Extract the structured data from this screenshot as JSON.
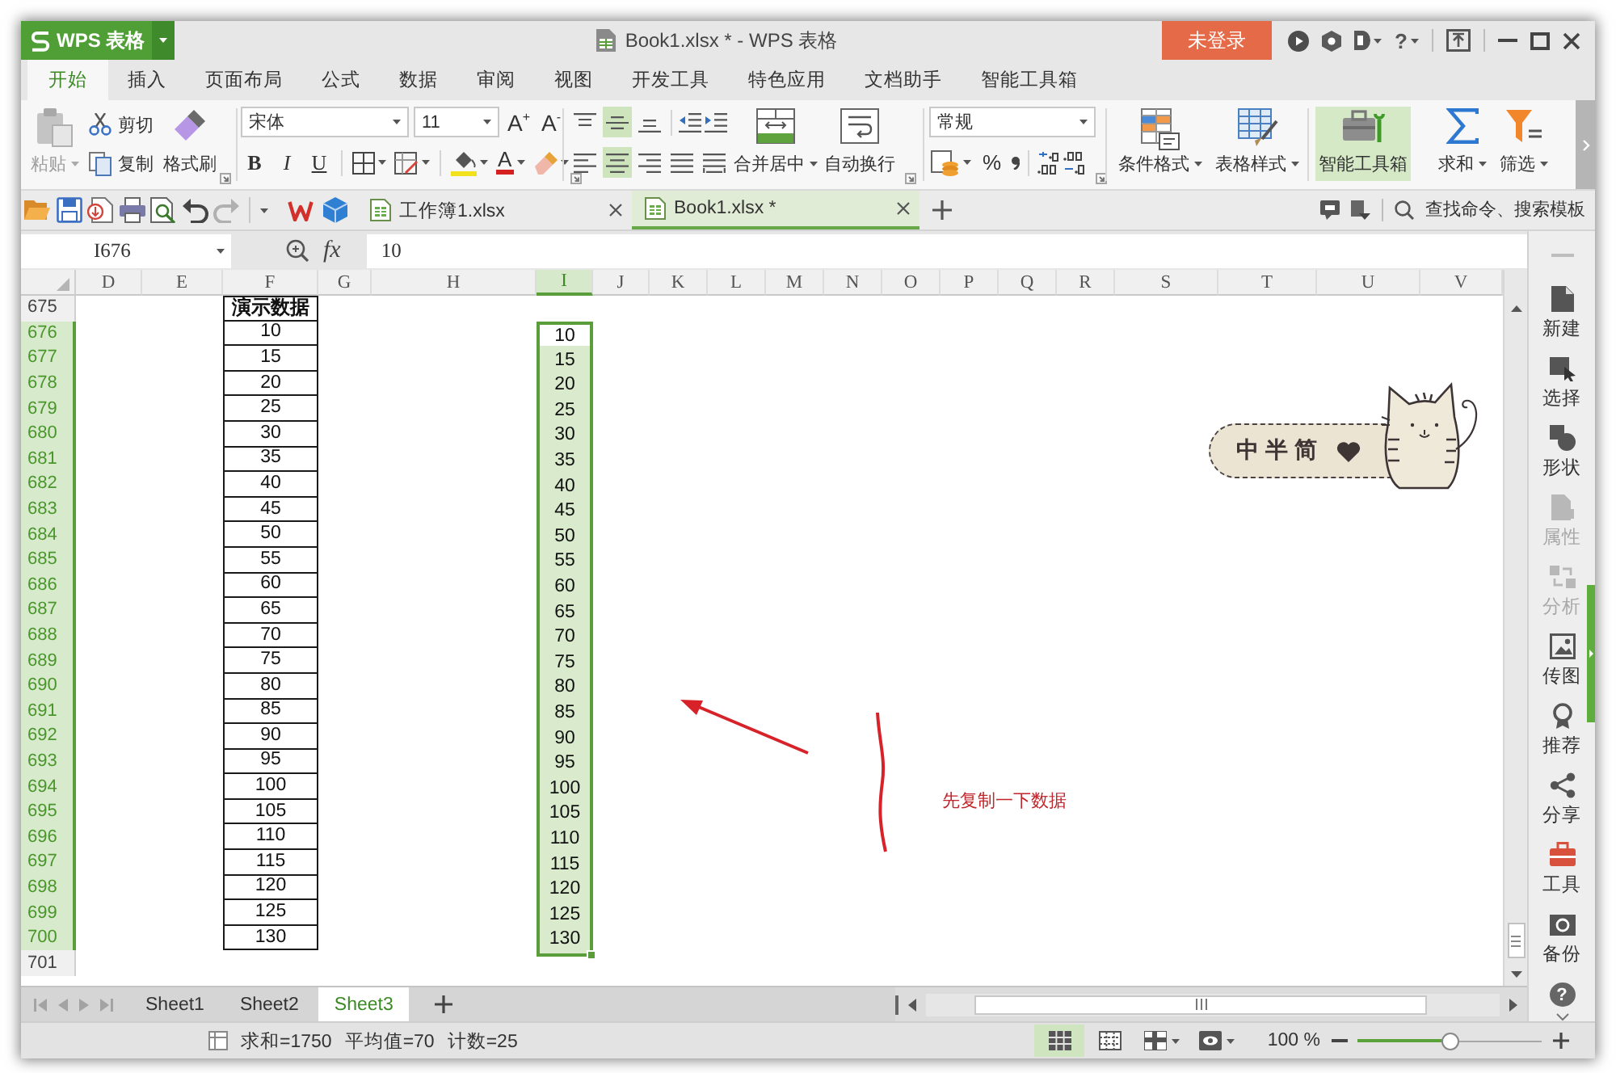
{
  "app_button": {
    "label": "WPS 表格"
  },
  "window": {
    "title": "Book1.xlsx * - WPS 表格",
    "login": "未登录",
    "help": "?"
  },
  "menu_tabs": [
    {
      "label": "开始",
      "selected": true
    },
    {
      "label": "插入",
      "selected": false
    },
    {
      "label": "页面布局",
      "selected": false
    },
    {
      "label": "公式",
      "selected": false
    },
    {
      "label": "数据",
      "selected": false
    },
    {
      "label": "审阅",
      "selected": false
    },
    {
      "label": "视图",
      "selected": false
    },
    {
      "label": "开发工具",
      "selected": false
    },
    {
      "label": "特色应用",
      "selected": false
    },
    {
      "label": "文档助手",
      "selected": false
    },
    {
      "label": "智能工具箱",
      "selected": false
    }
  ],
  "ribbon": {
    "paste": {
      "label": "粘贴",
      "disabled": true
    },
    "cut": "剪切",
    "copy": "复制",
    "format_painter": "格式刷",
    "font_name": "宋体",
    "font_size": "11",
    "grow_font": "A$^{+}$",
    "shrink_font": "A$^{-}$",
    "font_styles": [
      {
        "kind": "bold",
        "label": "B"
      },
      {
        "kind": "italic",
        "label": "I"
      },
      {
        "kind": "underline",
        "label": "U"
      }
    ],
    "font_color": "A",
    "vertical_align": [
      {
        "kind": "top",
        "selected": false
      },
      {
        "kind": "middle",
        "selected": true
      },
      {
        "kind": "bottom",
        "selected": false
      }
    ],
    "horizontal_align": [
      {
        "kind": "left",
        "selected": false
      },
      {
        "kind": "center",
        "selected": true
      },
      {
        "kind": "right",
        "selected": false
      },
      {
        "kind": "justify",
        "selected": false
      },
      {
        "kind": "distributed",
        "selected": false
      }
    ],
    "merge_center": "合并居中",
    "wrap_text": "自动换行",
    "number_format": "常规",
    "percent": "%",
    "conditional_format": "条件格式",
    "table_style": "表格样式",
    "smart_toolbox": {
      "label": "智能工具箱",
      "selected": true
    },
    "sum": "求和",
    "filter": "筛选"
  },
  "quick_access": [
    {
      "kind": "open",
      "disabled": false
    },
    {
      "kind": "save",
      "disabled": false
    },
    {
      "kind": "export",
      "disabled": false
    },
    {
      "kind": "print",
      "disabled": false
    },
    {
      "kind": "preview",
      "disabled": false
    },
    {
      "kind": "undo",
      "disabled": false
    },
    {
      "kind": "redo",
      "disabled": true
    }
  ],
  "document_tabs": [
    {
      "label": "工作簿1.xlsx",
      "selected": false
    },
    {
      "label": "Book1.xlsx *",
      "selected": true
    }
  ],
  "search": {
    "placeholder": "查找命令、搜索模板"
  },
  "formula_bar": {
    "cell_ref": "I676",
    "function_label": "fx",
    "value": "10"
  },
  "columns": [
    {
      "label": "D",
      "selected": false
    },
    {
      "label": "E",
      "selected": false
    },
    {
      "label": "F",
      "selected": false
    },
    {
      "label": "G",
      "selected": false
    },
    {
      "label": "H",
      "selected": false
    },
    {
      "label": "I",
      "selected": true
    },
    {
      "label": "J",
      "selected": false
    },
    {
      "label": "K",
      "selected": false
    },
    {
      "label": "L",
      "selected": false
    },
    {
      "label": "M",
      "selected": false
    },
    {
      "label": "N",
      "selected": false
    },
    {
      "label": "O",
      "selected": false
    },
    {
      "label": "P",
      "selected": false
    },
    {
      "label": "Q",
      "selected": false
    },
    {
      "label": "R",
      "selected": false
    },
    {
      "label": "S",
      "selected": false
    },
    {
      "label": "T",
      "selected": false
    },
    {
      "label": "U",
      "selected": false
    },
    {
      "label": "V",
      "selected": false
    }
  ],
  "rows": [
    {
      "label": "675",
      "selected": false,
      "kind": "header",
      "column_f": "演示数据"
    },
    {
      "label": "676",
      "selected": true,
      "kind": "data",
      "column_f": "10",
      "column_i": {
        "text": "10",
        "active": true
      }
    },
    {
      "label": "677",
      "selected": true,
      "kind": "data",
      "column_f": "15",
      "column_i": {
        "text": "15",
        "active": false
      }
    },
    {
      "label": "678",
      "selected": true,
      "kind": "data",
      "column_f": "20",
      "column_i": {
        "text": "20",
        "active": false
      }
    },
    {
      "label": "679",
      "selected": true,
      "kind": "data",
      "column_f": "25",
      "column_i": {
        "text": "25",
        "active": false
      }
    },
    {
      "label": "680",
      "selected": true,
      "kind": "data",
      "column_f": "30",
      "column_i": {
        "text": "30",
        "active": false
      }
    },
    {
      "label": "681",
      "selected": true,
      "kind": "data",
      "column_f": "35",
      "column_i": {
        "text": "35",
        "active": false
      }
    },
    {
      "label": "682",
      "selected": true,
      "kind": "data",
      "column_f": "40",
      "column_i": {
        "text": "40",
        "active": false
      }
    },
    {
      "label": "683",
      "selected": true,
      "kind": "data",
      "column_f": "45",
      "column_i": {
        "text": "45",
        "active": false
      }
    },
    {
      "label": "684",
      "selected": true,
      "kind": "data",
      "column_f": "50",
      "column_i": {
        "text": "50",
        "active": false
      }
    },
    {
      "label": "685",
      "selected": true,
      "kind": "data",
      "column_f": "55",
      "column_i": {
        "text": "55",
        "active": false
      }
    },
    {
      "label": "686",
      "selected": true,
      "kind": "data",
      "column_f": "60",
      "column_i": {
        "text": "60",
        "active": false
      }
    },
    {
      "label": "687",
      "selected": true,
      "kind": "data",
      "column_f": "65",
      "column_i": {
        "text": "65",
        "active": false
      }
    },
    {
      "label": "688",
      "selected": true,
      "kind": "data",
      "column_f": "70",
      "column_i": {
        "text": "70",
        "active": false
      }
    },
    {
      "label": "689",
      "selected": true,
      "kind": "data",
      "column_f": "75",
      "column_i": {
        "text": "75",
        "active": false
      }
    },
    {
      "label": "690",
      "selected": true,
      "kind": "data",
      "column_f": "80",
      "column_i": {
        "text": "80",
        "active": false
      }
    },
    {
      "label": "691",
      "selected": true,
      "kind": "data",
      "column_f": "85",
      "column_i": {
        "text": "85",
        "active": false
      }
    },
    {
      "label": "692",
      "selected": true,
      "kind": "data",
      "column_f": "90",
      "column_i": {
        "text": "90",
        "active": false
      }
    },
    {
      "label": "693",
      "selected": true,
      "kind": "data",
      "column_f": "95",
      "column_i": {
        "text": "95",
        "active": false
      }
    },
    {
      "label": "694",
      "selected": true,
      "kind": "data",
      "column_f": "100",
      "column_i": {
        "text": "100",
        "active": false
      }
    },
    {
      "label": "695",
      "selected": true,
      "kind": "data",
      "column_f": "105",
      "column_i": {
        "text": "105",
        "active": false
      }
    },
    {
      "label": "696",
      "selected": true,
      "kind": "data",
      "column_f": "110",
      "column_i": {
        "text": "110",
        "active": false
      }
    },
    {
      "label": "697",
      "selected": true,
      "kind": "data",
      "column_f": "115",
      "column_i": {
        "text": "115",
        "active": false
      }
    },
    {
      "label": "698",
      "selected": true,
      "kind": "data",
      "column_f": "120",
      "column_i": {
        "text": "120",
        "active": false
      }
    },
    {
      "label": "699",
      "selected": true,
      "kind": "data",
      "column_f": "125",
      "column_i": {
        "text": "125",
        "active": false
      }
    },
    {
      "label": "700",
      "selected": true,
      "kind": "data",
      "column_f": "130",
      "column_i": {
        "text": "130",
        "active": false
      }
    },
    {
      "label": "701",
      "selected": false,
      "kind": "blank"
    }
  ],
  "sticker": {
    "text": "中半简"
  },
  "annotation": {
    "text": "先复制一下数据"
  },
  "side_panel": {
    "items": [
      {
        "label": "新建",
        "kind": "new",
        "disabled": false
      },
      {
        "label": "选择",
        "kind": "select",
        "disabled": false
      },
      {
        "label": "形状",
        "kind": "shape",
        "disabled": false
      },
      {
        "label": "属性",
        "kind": "properties",
        "disabled": true
      },
      {
        "label": "分析",
        "kind": "analysis",
        "disabled": true
      },
      {
        "label": "传图",
        "kind": "upload",
        "disabled": false
      },
      {
        "label": "推荐",
        "kind": "recommend",
        "disabled": false
      },
      {
        "label": "分享",
        "kind": "share",
        "disabled": false
      },
      {
        "label": "工具",
        "kind": "tools",
        "disabled": false
      },
      {
        "label": "备份",
        "kind": "backup",
        "disabled": false
      }
    ],
    "help": "?"
  },
  "sheet_tabs": [
    {
      "label": "Sheet1",
      "selected": false
    },
    {
      "label": "Sheet2",
      "selected": false
    },
    {
      "label": "Sheet3",
      "selected": true
    }
  ],
  "status_bar": {
    "sum": "求和=1750",
    "average": "平均值=70",
    "count": "计数=25"
  },
  "view_modes": [
    {
      "kind": "normal",
      "selected": true
    },
    {
      "kind": "page_break",
      "selected": false
    }
  ],
  "zoom": {
    "label": "100 %",
    "level": 0.5
  }
}
